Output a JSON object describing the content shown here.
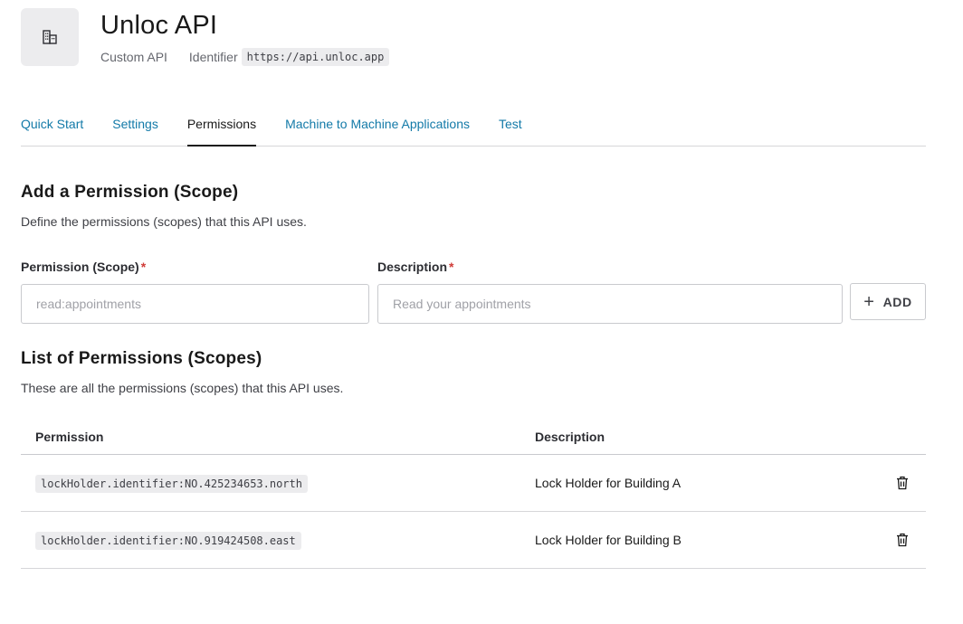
{
  "api": {
    "name": "Unloc API",
    "type": "Custom API",
    "identifier_label": "Identifier",
    "identifier": "https://api.unloc.app",
    "logo_icon": "building-icon"
  },
  "tabs": [
    {
      "label": "Quick Start",
      "active": false
    },
    {
      "label": "Settings",
      "active": false
    },
    {
      "label": "Permissions",
      "active": true
    },
    {
      "label": "Machine to Machine Applications",
      "active": false
    },
    {
      "label": "Test",
      "active": false
    }
  ],
  "add_section": {
    "title": "Add a Permission (Scope)",
    "description": "Define the permissions (scopes) that this API uses.",
    "scope_label": "Permission (Scope)",
    "scope_placeholder": "read:appointments",
    "scope_value": "",
    "desc_label": "Description",
    "desc_placeholder": "Read your appointments",
    "desc_value": "",
    "required_mark": "*",
    "add_button": "ADD"
  },
  "list_section": {
    "title": "List of Permissions (Scopes)",
    "description": "These are all the permissions (scopes) that this API uses.",
    "columns": {
      "permission": "Permission",
      "description": "Description"
    },
    "rows": [
      {
        "permission": "lockHolder.identifier:NO.425234653.north",
        "description": "Lock Holder for Building A"
      },
      {
        "permission": "lockHolder.identifier:NO.919424508.east",
        "description": "Lock Holder for Building B"
      }
    ]
  },
  "colors": {
    "link": "#137aa8",
    "required": "#d03c38",
    "pill_bg": "#ececee"
  }
}
